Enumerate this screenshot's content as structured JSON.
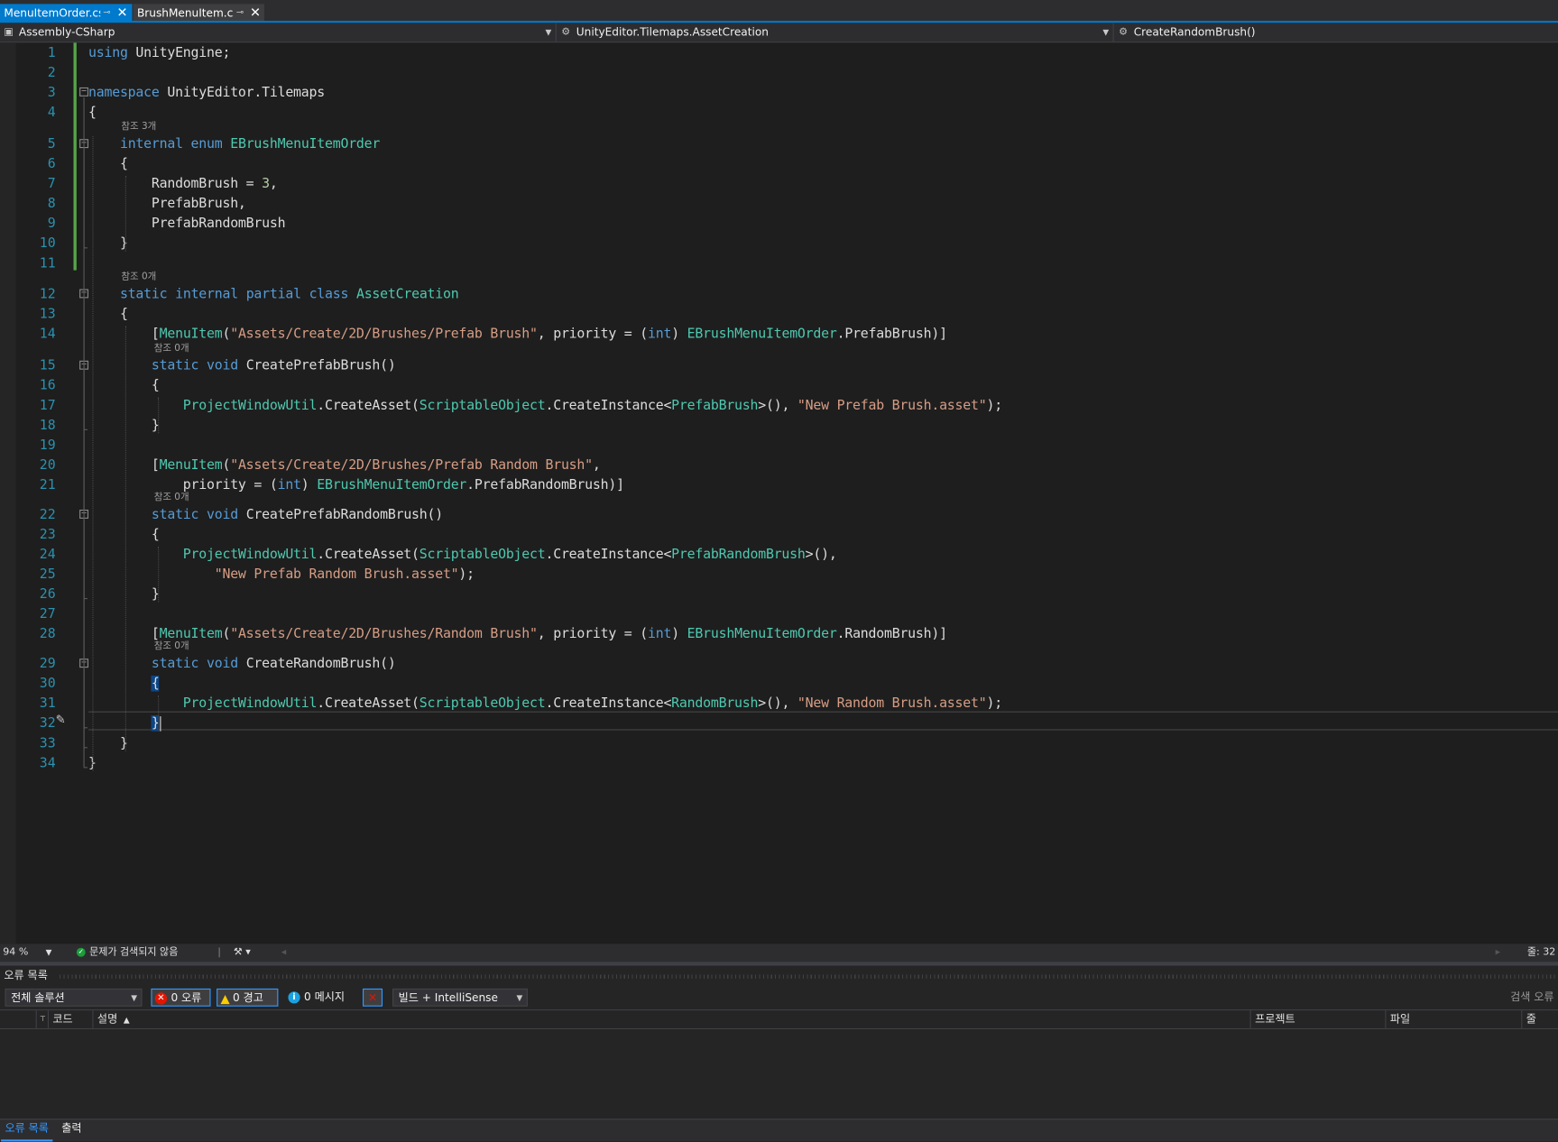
{
  "tabs": [
    {
      "label": "MenuItemOrder.cs",
      "pin": "⊸",
      "close": "✕",
      "active": true
    },
    {
      "label": "BrushMenuItem.cs",
      "pin": "⊸",
      "close": "✕",
      "active": false
    }
  ],
  "navbar": {
    "project": "Assembly-CSharp",
    "namespace": "UnityEditor.Tilemaps.AssetCreation",
    "member": "CreateRandomBrush()",
    "project_icon": "csharp-project-icon",
    "namespace_icon": "class-icon",
    "member_icon": "method-icon"
  },
  "code": {
    "lines": [
      {
        "n": "1",
        "tokens": [
          {
            "t": "using",
            "c": "kw"
          },
          {
            "t": " UnityEngine;"
          }
        ]
      },
      {
        "n": "2",
        "tokens": []
      },
      {
        "n": "3",
        "tokens": [
          {
            "t": "namespace",
            "c": "kw"
          },
          {
            "t": " UnityEditor.Tilemaps"
          }
        ]
      },
      {
        "n": "4",
        "tokens": [
          {
            "t": "{"
          }
        ]
      },
      {
        "n": "5",
        "hint": "참조 3개",
        "tokens": [
          {
            "t": "    "
          },
          {
            "t": "internal",
            "c": "kw"
          },
          {
            "t": " "
          },
          {
            "t": "enum",
            "c": "kw"
          },
          {
            "t": " "
          },
          {
            "t": "EBrushMenuItemOrder",
            "c": "ty"
          }
        ]
      },
      {
        "n": "6",
        "tokens": [
          {
            "t": "    {"
          }
        ]
      },
      {
        "n": "7",
        "tokens": [
          {
            "t": "        RandomBrush = "
          },
          {
            "t": "3",
            "c": "nm"
          },
          {
            "t": ","
          }
        ]
      },
      {
        "n": "8",
        "tokens": [
          {
            "t": "        PrefabBrush,"
          }
        ]
      },
      {
        "n": "9",
        "tokens": [
          {
            "t": "        PrefabRandomBrush"
          }
        ]
      },
      {
        "n": "10",
        "tokens": [
          {
            "t": "    }"
          }
        ]
      },
      {
        "n": "11",
        "tokens": []
      },
      {
        "n": "12",
        "hint": "참조 0개",
        "tokens": [
          {
            "t": "    "
          },
          {
            "t": "static",
            "c": "kw"
          },
          {
            "t": " "
          },
          {
            "t": "internal",
            "c": "kw"
          },
          {
            "t": " "
          },
          {
            "t": "partial",
            "c": "kw"
          },
          {
            "t": " "
          },
          {
            "t": "class",
            "c": "kw"
          },
          {
            "t": " "
          },
          {
            "t": "AssetCreation",
            "c": "ty"
          }
        ]
      },
      {
        "n": "13",
        "tokens": [
          {
            "t": "    {"
          }
        ]
      },
      {
        "n": "14",
        "tokens": [
          {
            "t": "        ["
          },
          {
            "t": "MenuItem",
            "c": "ty"
          },
          {
            "t": "("
          },
          {
            "t": "\"Assets/Create/2D/Brushes/Prefab Brush\"",
            "c": "st"
          },
          {
            "t": ", priority = ("
          },
          {
            "t": "int",
            "c": "kw"
          },
          {
            "t": ") "
          },
          {
            "t": "EBrushMenuItemOrder",
            "c": "ty"
          },
          {
            "t": ".PrefabBrush)]"
          }
        ]
      },
      {
        "n": "15",
        "hint": "참조 0개",
        "tokens": [
          {
            "t": "        "
          },
          {
            "t": "static",
            "c": "kw"
          },
          {
            "t": " "
          },
          {
            "t": "void",
            "c": "kw"
          },
          {
            "t": " CreatePrefabBrush()"
          }
        ]
      },
      {
        "n": "16",
        "tokens": [
          {
            "t": "        {"
          }
        ]
      },
      {
        "n": "17",
        "tokens": [
          {
            "t": "            "
          },
          {
            "t": "ProjectWindowUtil",
            "c": "ty"
          },
          {
            "t": ".CreateAsset("
          },
          {
            "t": "ScriptableObject",
            "c": "ty"
          },
          {
            "t": ".CreateInstance<"
          },
          {
            "t": "PrefabBrush",
            "c": "ty"
          },
          {
            "t": ">(), "
          },
          {
            "t": "\"New Prefab Brush.asset\"",
            "c": "st"
          },
          {
            "t": ");"
          }
        ]
      },
      {
        "n": "18",
        "tokens": [
          {
            "t": "        }"
          }
        ]
      },
      {
        "n": "19",
        "tokens": []
      },
      {
        "n": "20",
        "tokens": [
          {
            "t": "        ["
          },
          {
            "t": "MenuItem",
            "c": "ty"
          },
          {
            "t": "("
          },
          {
            "t": "\"Assets/Create/2D/Brushes/Prefab Random Brush\"",
            "c": "st"
          },
          {
            "t": ","
          }
        ]
      },
      {
        "n": "21",
        "tokens": [
          {
            "t": "            priority = ("
          },
          {
            "t": "int",
            "c": "kw"
          },
          {
            "t": ") "
          },
          {
            "t": "EBrushMenuItemOrder",
            "c": "ty"
          },
          {
            "t": ".PrefabRandomBrush)]"
          }
        ]
      },
      {
        "n": "22",
        "hint": "참조 0개",
        "tokens": [
          {
            "t": "        "
          },
          {
            "t": "static",
            "c": "kw"
          },
          {
            "t": " "
          },
          {
            "t": "void",
            "c": "kw"
          },
          {
            "t": " CreatePrefabRandomBrush()"
          }
        ]
      },
      {
        "n": "23",
        "tokens": [
          {
            "t": "        {"
          }
        ]
      },
      {
        "n": "24",
        "tokens": [
          {
            "t": "            "
          },
          {
            "t": "ProjectWindowUtil",
            "c": "ty"
          },
          {
            "t": ".CreateAsset("
          },
          {
            "t": "ScriptableObject",
            "c": "ty"
          },
          {
            "t": ".CreateInstance<"
          },
          {
            "t": "PrefabRandomBrush",
            "c": "ty"
          },
          {
            "t": ">(),"
          }
        ]
      },
      {
        "n": "25",
        "tokens": [
          {
            "t": "                "
          },
          {
            "t": "\"New Prefab Random Brush.asset\"",
            "c": "st"
          },
          {
            "t": ");"
          }
        ]
      },
      {
        "n": "26",
        "tokens": [
          {
            "t": "        }"
          }
        ]
      },
      {
        "n": "27",
        "tokens": []
      },
      {
        "n": "28",
        "tokens": [
          {
            "t": "        ["
          },
          {
            "t": "MenuItem",
            "c": "ty"
          },
          {
            "t": "("
          },
          {
            "t": "\"Assets/Create/2D/Brushes/Random Brush\"",
            "c": "st"
          },
          {
            "t": ", priority = ("
          },
          {
            "t": "int",
            "c": "kw"
          },
          {
            "t": ") "
          },
          {
            "t": "EBrushMenuItemOrder",
            "c": "ty"
          },
          {
            "t": ".RandomBrush)]"
          }
        ]
      },
      {
        "n": "29",
        "hint": "참조 0개",
        "tokens": [
          {
            "t": "        "
          },
          {
            "t": "static",
            "c": "kw"
          },
          {
            "t": " "
          },
          {
            "t": "void",
            "c": "kw"
          },
          {
            "t": " CreateRandomBrush()"
          }
        ]
      },
      {
        "n": "30",
        "tokens": [
          {
            "t": "        "
          },
          {
            "t": "{",
            "c": "brh"
          }
        ]
      },
      {
        "n": "31",
        "tokens": [
          {
            "t": "            "
          },
          {
            "t": "ProjectWindowUtil",
            "c": "ty"
          },
          {
            "t": ".CreateAsset("
          },
          {
            "t": "ScriptableObject",
            "c": "ty"
          },
          {
            "t": ".CreateInstance<"
          },
          {
            "t": "RandomBrush",
            "c": "ty"
          },
          {
            "t": ">(), "
          },
          {
            "t": "\"New Random Brush.asset\"",
            "c": "st"
          },
          {
            "t": ");"
          }
        ]
      },
      {
        "n": "32",
        "tokens": [
          {
            "t": "        "
          },
          {
            "t": "}",
            "c": "brh"
          }
        ]
      },
      {
        "n": "33",
        "tokens": [
          {
            "t": "    }"
          }
        ]
      },
      {
        "n": "34",
        "tokens": [
          {
            "t": "}"
          }
        ]
      }
    ]
  },
  "status": {
    "zoom": "94 %",
    "issues": "문제가 검색되지 않음",
    "line_col": "줄: 32",
    "ok_icon": "check-circle-icon",
    "brush_icon": "cleanup-brush-icon"
  },
  "error_list": {
    "title": "오류 목록",
    "scope": "전체 솔루션",
    "errors": "0 오류",
    "warnings": "0 경고",
    "messages": "0 메시지",
    "build_filter": "빌드 + IntelliSense",
    "search": "검색 오류",
    "columns": {
      "code": "코드",
      "description": "설명",
      "project": "프로젝트",
      "file": "파일",
      "line": "줄"
    }
  },
  "bottom_tabs": [
    "오류 목록",
    "출력"
  ]
}
